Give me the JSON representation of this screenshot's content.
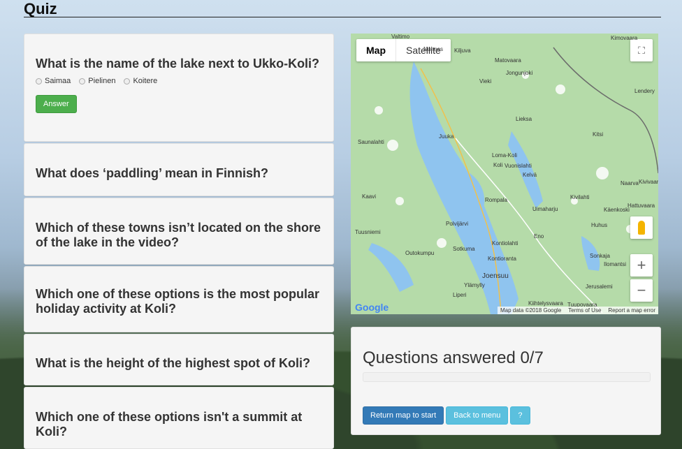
{
  "page_title": "Quiz",
  "questions": [
    {
      "text": "What is the name of the lake next to Ukko-Koli?",
      "options": [
        "Saimaa",
        "Pielinen",
        "Koitere"
      ],
      "answer_label": "Answer"
    },
    {
      "text": "What does ‘paddling’ mean in Finnish?"
    },
    {
      "text": "Which of these towns isn’t located on the shore of the lake in the video?"
    },
    {
      "text": "Which one of these options is the most popular holiday activity at Koli?"
    },
    {
      "text": "What is the height of the highest spot of Koli?"
    },
    {
      "text": "Which one of these options isn't a summit at Koli?"
    }
  ],
  "map": {
    "type_tabs": [
      "Map",
      "Satellite"
    ],
    "labels": [
      "Valtimo",
      "Nurmes",
      "Kiljuva",
      "Matovaara",
      "Jongunjoki",
      "Vieki",
      "Lieksa",
      "Kitsi",
      "Juuka",
      "Saunalahti",
      "Loma-Koli",
      "Koli",
      "Vuonislahti",
      "Kelvä",
      "Kaavi",
      "Nurmes",
      "Kivilahti",
      "Hattuvaara",
      "Rompala",
      "Uimaharju",
      "Käenkoski",
      "Polvijärvi",
      "Huhus",
      "Tuusniemi",
      "Eno",
      "Outokumpu",
      "Sotkuma",
      "Kontiolahti",
      "Kontioranta",
      "Sonkaja",
      "Ilomantsi",
      "Joensuu",
      "Ylämylly",
      "Jerusalemi",
      "Liperi",
      "Kiihtelysvaara",
      "Tuupovaara",
      "Lendery",
      "Kimovaara",
      "Naarva",
      "Kivivaara"
    ],
    "google_logo": "Google",
    "footer": [
      "Map data ©2018 Google",
      "Terms of Use",
      "Report a map error"
    ],
    "zoom_in": "+",
    "zoom_out": "−"
  },
  "status": {
    "answered_text": "Questions answered 0/7",
    "progress": 0
  },
  "buttons": {
    "return_map": "Return map to start",
    "back_menu": "Back to menu",
    "help": "?"
  },
  "colors": {
    "answer_button": "#4cae4c",
    "primary_button": "#337ab7",
    "info_button": "#5bc0de"
  }
}
